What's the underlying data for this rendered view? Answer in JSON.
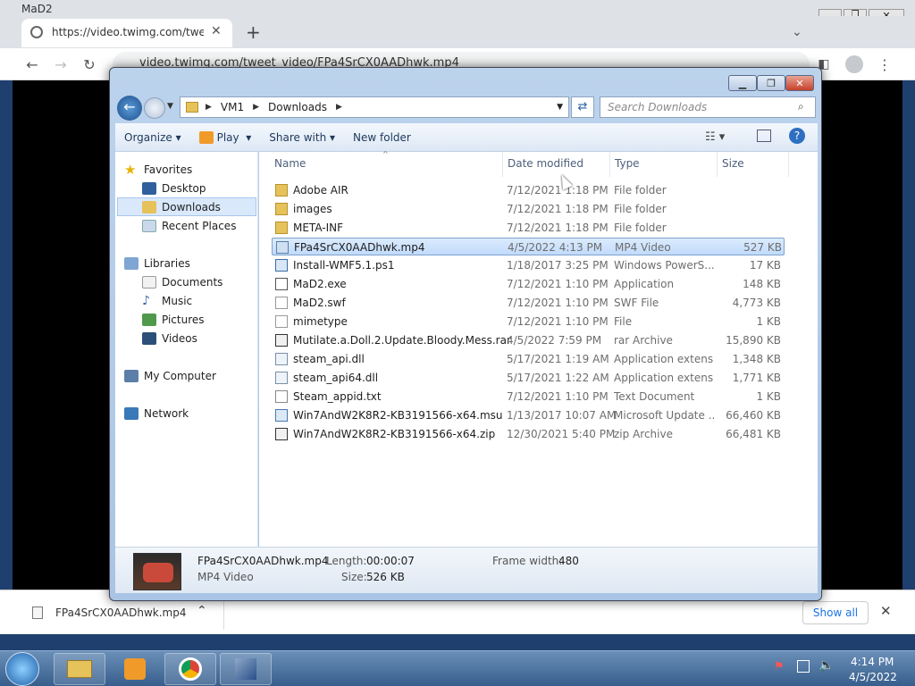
{
  "browser": {
    "window_title": "MaD2",
    "tab_title": "https://video.twimg.com/tweet_v",
    "omnibox_url": "video.twimg.com/tweet_video/FPa4SrCX0AADhwk.mp4",
    "new_tab_label": "+",
    "download_bar": {
      "file_name": "FPa4SrCX0AADhwk.mp4",
      "show_all_label": "Show all"
    }
  },
  "explorer": {
    "breadcrumb": [
      "VM1",
      "Downloads"
    ],
    "search_placeholder": "Search Downloads",
    "toolbar": {
      "organize": "Organize",
      "play": "Play",
      "share_with": "Share with",
      "new_folder": "New folder"
    },
    "nav": {
      "favorites": "Favorites",
      "desktop": "Desktop",
      "downloads": "Downloads",
      "recent_places": "Recent Places",
      "libraries": "Libraries",
      "documents": "Documents",
      "music": "Music",
      "pictures": "Pictures",
      "videos": "Videos",
      "my_computer": "My Computer",
      "network": "Network"
    },
    "columns": {
      "name": "Name",
      "date": "Date modified",
      "type": "Type",
      "size": "Size"
    },
    "files": [
      {
        "name": "Adobe AIR",
        "date": "7/12/2021 1:18 PM",
        "type": "File folder",
        "size": "",
        "icon": "folder"
      },
      {
        "name": "images",
        "date": "7/12/2021 1:18 PM",
        "type": "File folder",
        "size": "",
        "icon": "folder"
      },
      {
        "name": "META-INF",
        "date": "7/12/2021 1:18 PM",
        "type": "File folder",
        "size": "",
        "icon": "folder"
      },
      {
        "name": "FPa4SrCX0AADhwk.mp4",
        "date": "4/5/2022 4:13 PM",
        "type": "MP4 Video",
        "size": "527 KB",
        "icon": "video"
      },
      {
        "name": "Install-WMF5.1.ps1",
        "date": "1/18/2017 3:25 PM",
        "type": "Windows PowerS...",
        "size": "17 KB",
        "icon": "script"
      },
      {
        "name": "MaD2.exe",
        "date": "7/12/2021 1:10 PM",
        "type": "Application",
        "size": "148 KB",
        "icon": "exe"
      },
      {
        "name": "MaD2.swf",
        "date": "7/12/2021 1:10 PM",
        "type": "SWF File",
        "size": "4,773 KB",
        "icon": "file"
      },
      {
        "name": "mimetype",
        "date": "7/12/2021 1:10 PM",
        "type": "File",
        "size": "1 KB",
        "icon": "file"
      },
      {
        "name": "Mutilate.a.Doll.2.Update.Bloody.Mess.rar",
        "date": "4/5/2022 7:59 PM",
        "type": "rar Archive",
        "size": "15,890 KB",
        "icon": "archive"
      },
      {
        "name": "steam_api.dll",
        "date": "5/17/2021 1:19 AM",
        "type": "Application extens...",
        "size": "1,348 KB",
        "icon": "dll"
      },
      {
        "name": "steam_api64.dll",
        "date": "5/17/2021 1:22 AM",
        "type": "Application extens...",
        "size": "1,771 KB",
        "icon": "dll"
      },
      {
        "name": "Steam_appid.txt",
        "date": "7/12/2021 1:10 PM",
        "type": "Text Document",
        "size": "1 KB",
        "icon": "text"
      },
      {
        "name": "Win7AndW2K8R2-KB3191566-x64.msu",
        "date": "1/13/2017 10:07 AM",
        "type": "Microsoft Update ...",
        "size": "66,460 KB",
        "icon": "update"
      },
      {
        "name": "Win7AndW2K8R2-KB3191566-x64.zip",
        "date": "12/30/2021 5:40 PM",
        "type": "zip Archive",
        "size": "66,481 KB",
        "icon": "archive"
      }
    ],
    "details": {
      "name": "FPa4SrCX0AADhwk.mp4",
      "type": "MP4 Video",
      "length_label": "Length:",
      "length": "00:00:07",
      "size_label": "Size:",
      "size": "526 KB",
      "frame_width_label": "Frame width:",
      "frame_width": "480"
    }
  },
  "taskbar": {
    "time": "4:14 PM",
    "date": "4/5/2022"
  }
}
